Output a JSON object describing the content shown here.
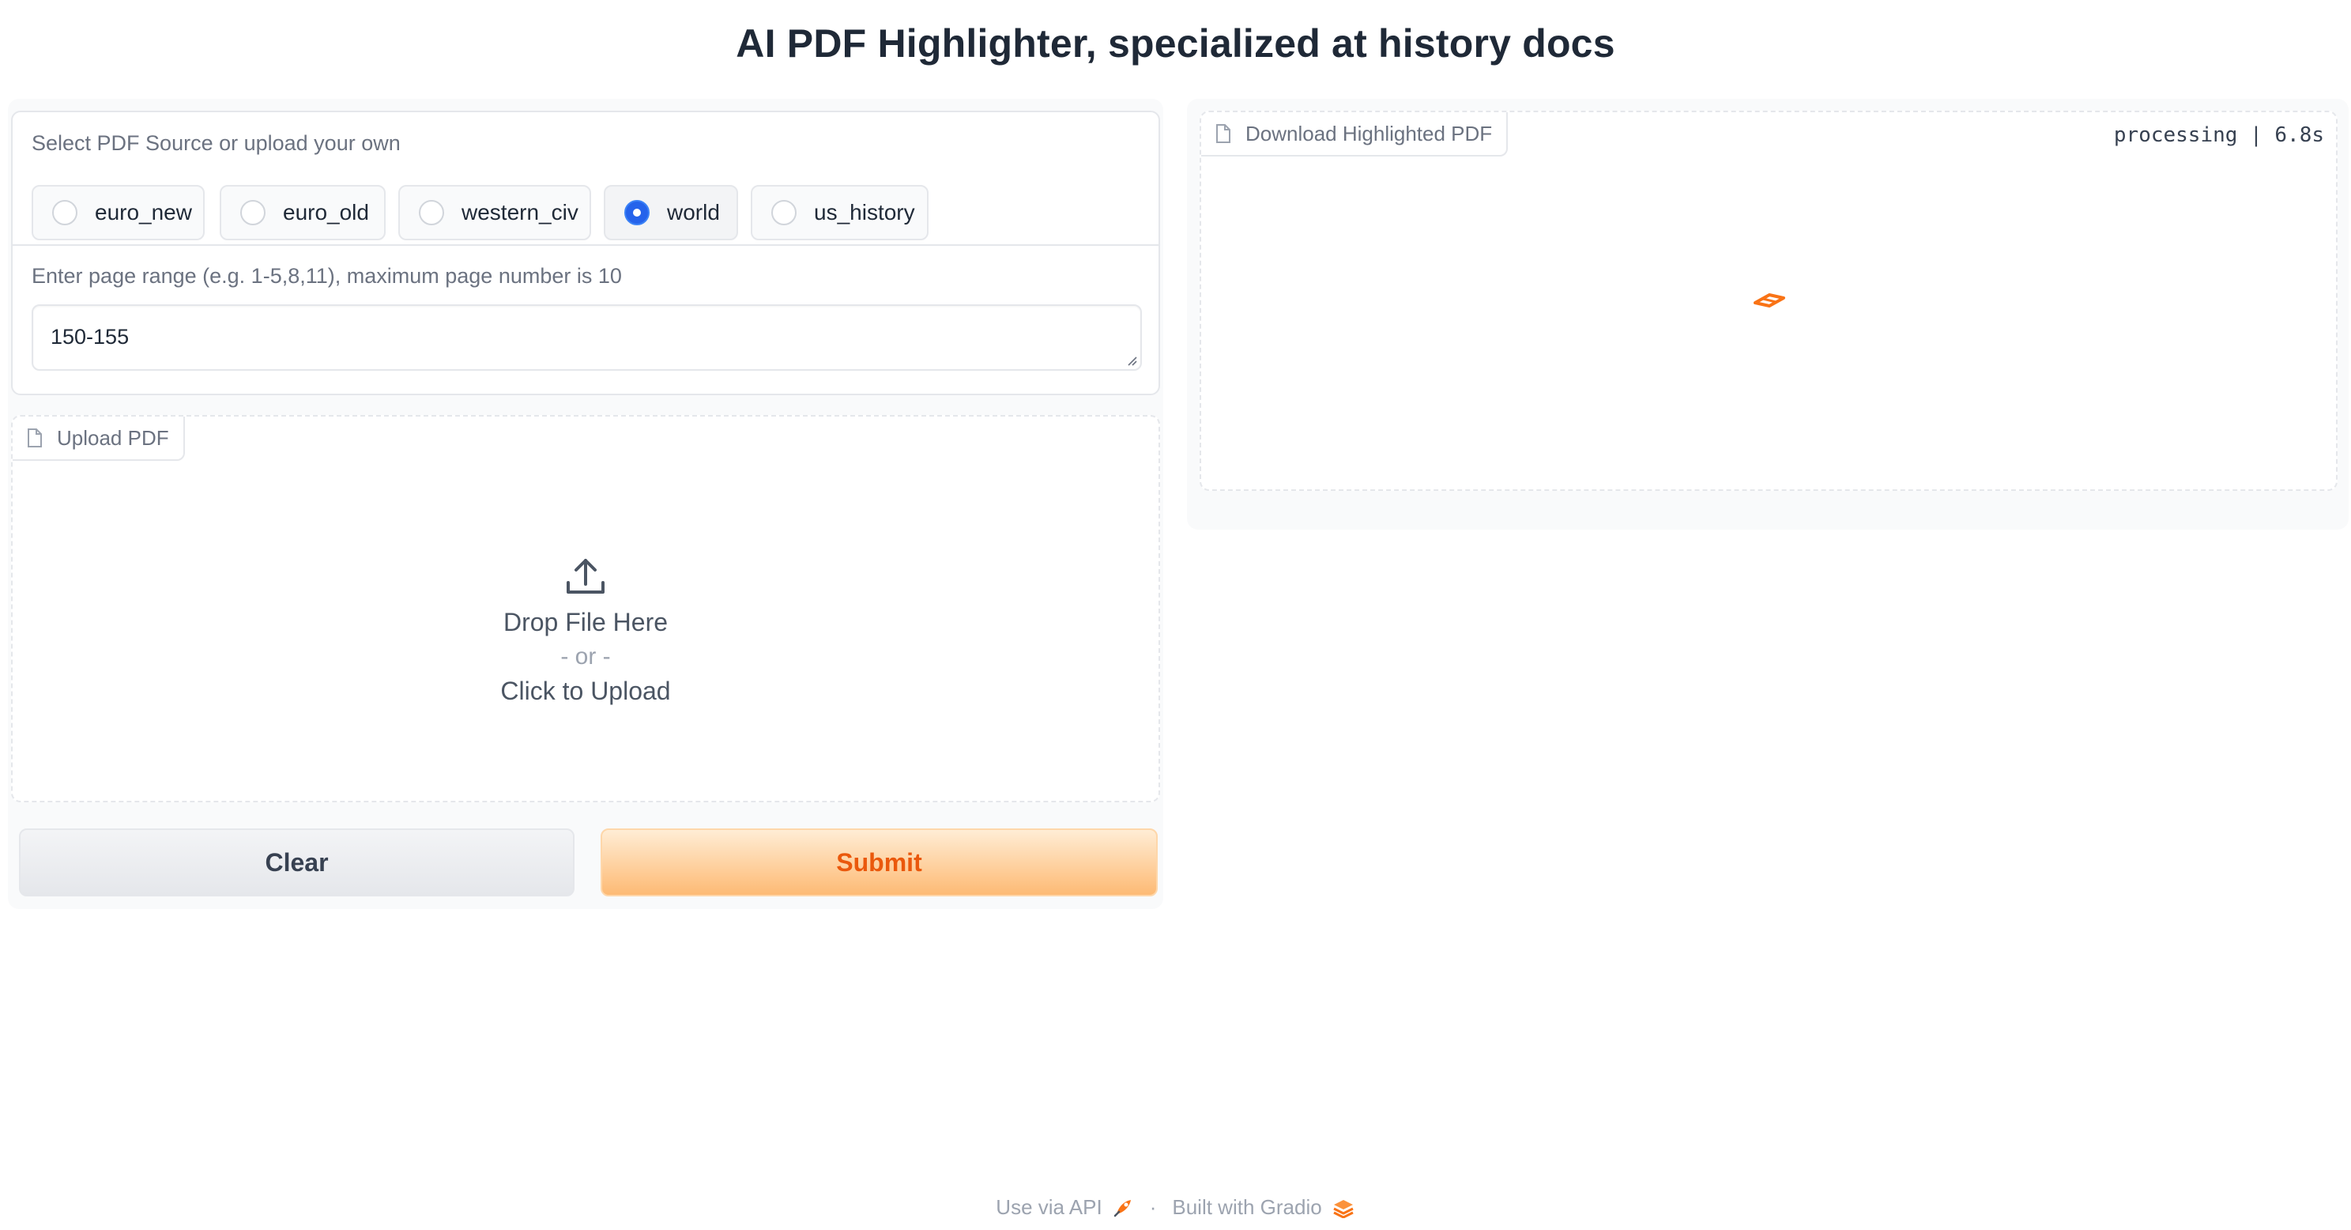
{
  "header": {
    "title": "AI PDF Highlighter, specialized at history docs"
  },
  "source": {
    "label": "Select PDF Source or upload your own",
    "options": [
      {
        "label": "euro_new",
        "checked": false
      },
      {
        "label": "euro_old",
        "checked": false
      },
      {
        "label": "western_civ",
        "checked": false
      },
      {
        "label": "world",
        "checked": true
      },
      {
        "label": "us_history",
        "checked": false
      }
    ],
    "selected": "world"
  },
  "page_range": {
    "label": "Enter page range (e.g. 1-5,8,11), maximum page number is 10",
    "value": "150-155"
  },
  "upload": {
    "tab_label": "Upload PDF",
    "drop_text": "Drop File Here",
    "or_text": "- or -",
    "click_text": "Click to Upload"
  },
  "buttons": {
    "clear_label": "Clear",
    "submit_label": "Submit"
  },
  "output": {
    "tab_label": "Download Highlighted PDF",
    "status": "processing | 6.8s"
  },
  "footer": {
    "api_label": "Use via API",
    "separator": "·",
    "built_label": "Built with Gradio"
  },
  "colors": {
    "accent": "#2563eb",
    "brand": "#f97316",
    "submit_text": "#ea580c"
  }
}
